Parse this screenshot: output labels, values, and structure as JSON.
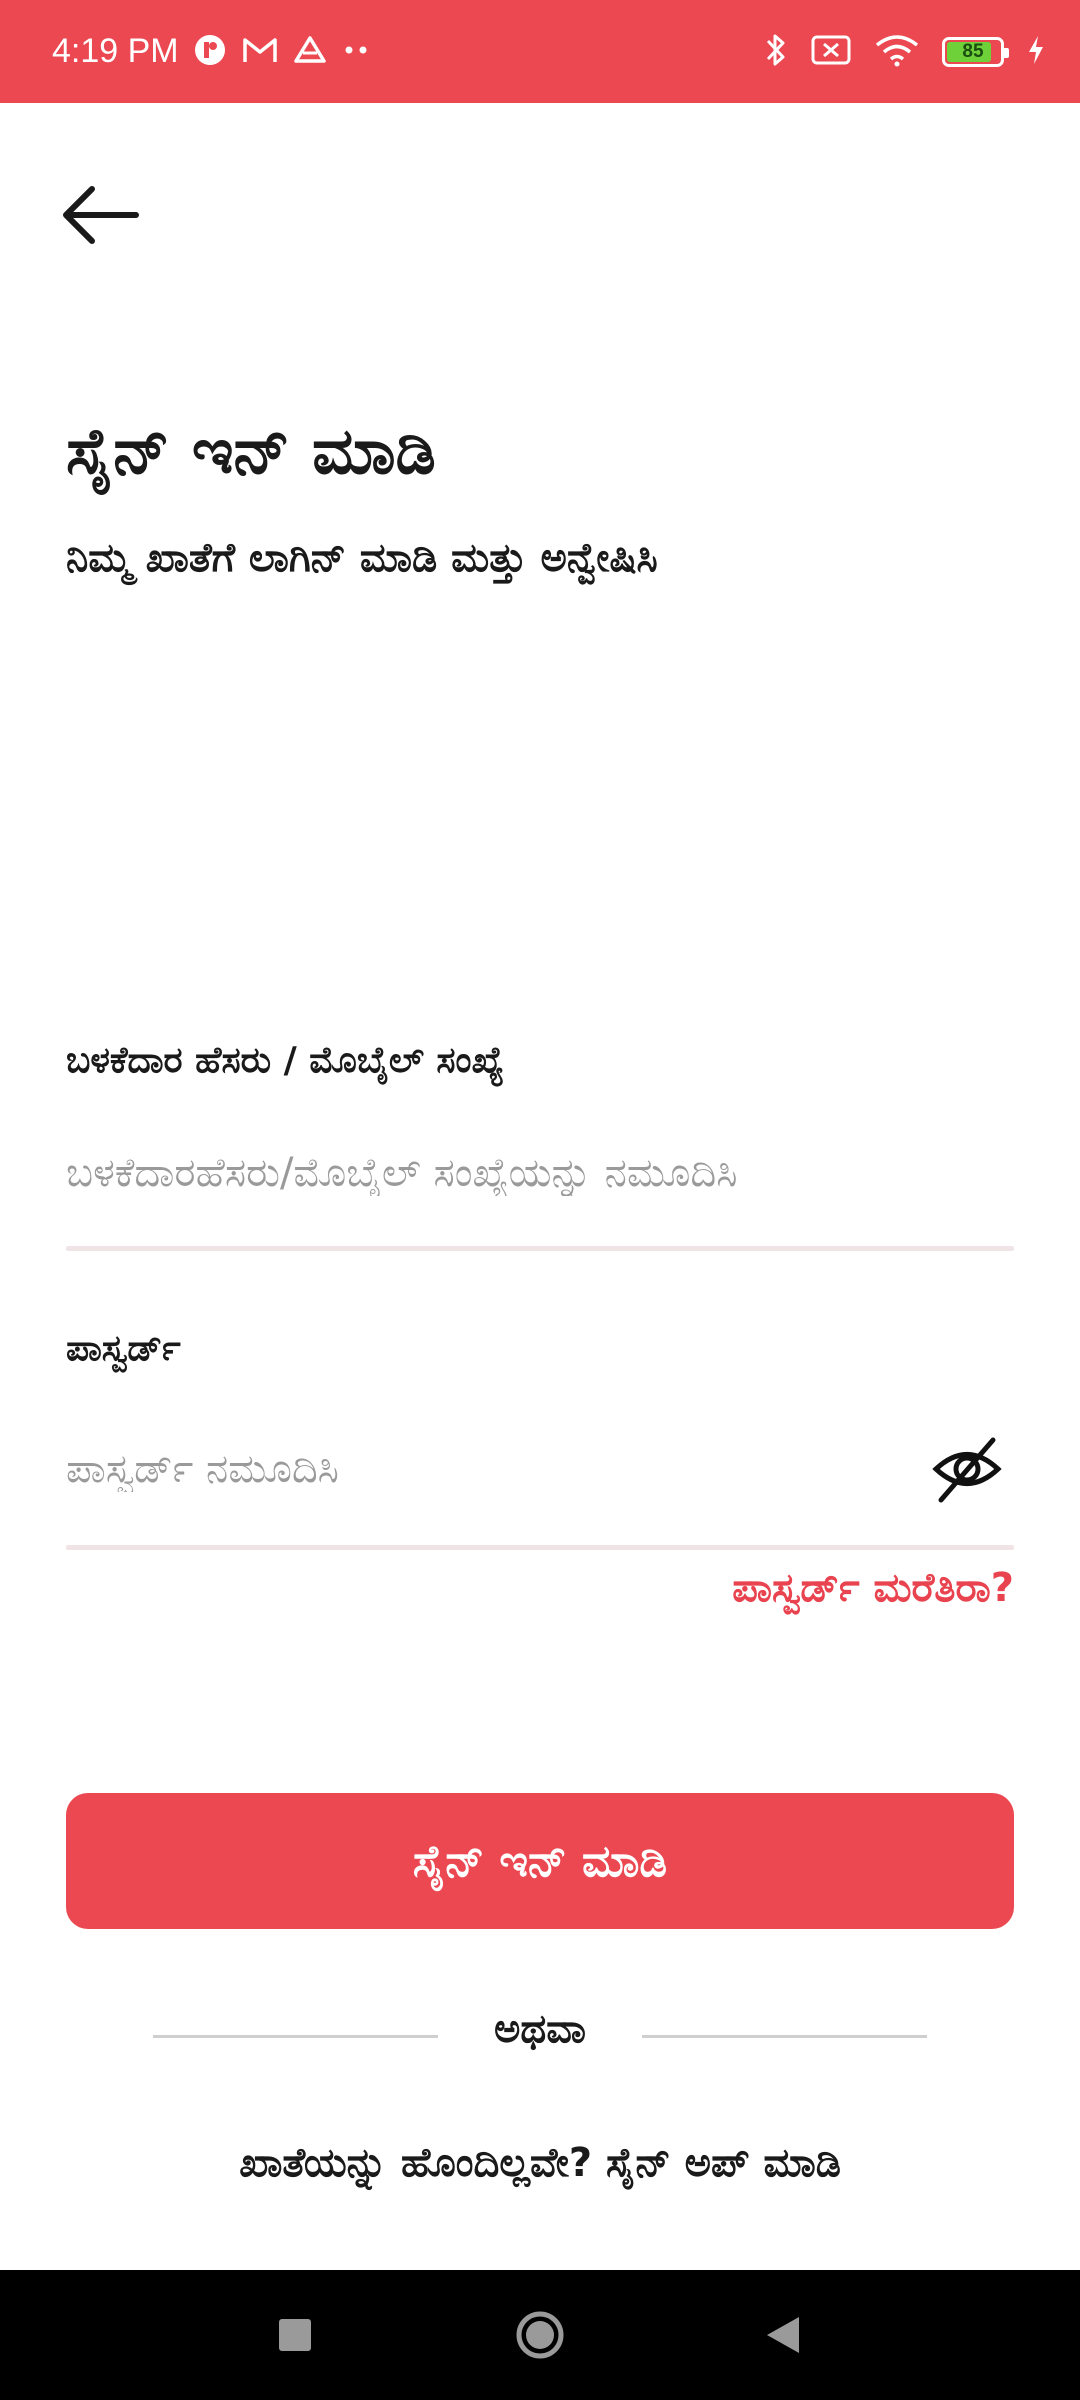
{
  "status_bar": {
    "time": "4:19 PM",
    "battery_level": "85",
    "battery_fraction": 0.85,
    "left_icons": [
      "app-notification-icon",
      "gmail-icon",
      "drive-icon",
      "more-dots-icon"
    ],
    "right_icons": [
      "bluetooth-icon",
      "no-sim-icon",
      "wifi-icon",
      "battery-icon",
      "charging-icon"
    ]
  },
  "header": {
    "back_icon": "arrow-left-icon"
  },
  "main": {
    "title": "ಸೈನ್ ಇನ್ ಮಾಡಿ",
    "subtitle": "ನಿಮ್ಮ ಖಾತೆಗೆ ಲಾಗಿನ್ ಮಾಡಿ ಮತ್ತು ಅನ್ವೇಷಿಸಿ"
  },
  "form": {
    "username": {
      "label": "ಬಳಕೆದಾರ ಹೆಸರು / ಮೊಬೈಲ್ ಸಂಖ್ಯೆ",
      "placeholder": "ಬಳಕೆದಾರಹೆಸರು/ಮೊಬೈಲ್ ಸಂಖ್ಯೆಯನ್ನು ನಮೂದಿಸಿ",
      "value": ""
    },
    "password": {
      "label": "ಪಾಸ್ವರ್ಡ್",
      "placeholder": "ಪಾಸ್ವರ್ಡ್ ನಮೂದಿಸಿ",
      "value": "",
      "toggle_icon": "eye-off-icon"
    },
    "forgot_password": "ಪಾಸ್ವರ್ಡ್ ಮರೆತಿರಾ?",
    "signin_button": "ಸೈನ್ ಇನ್ ಮಾಡಿ"
  },
  "divider": {
    "text": "ಅಥವಾ"
  },
  "signup": {
    "prompt": "ಖಾತೆಯನ್ನು ಹೊಂದಿಲ್ಲವೇ?",
    "link": "ಸೈನ್ ಅಪ್ ಮಾಡಿ"
  },
  "nav_bar": {
    "icons": [
      "recents-icon",
      "home-icon",
      "back-icon"
    ]
  },
  "colors": {
    "accent": "#ec4852",
    "link": "#e8434e",
    "text": "#1a1a1a",
    "placeholder": "#9a9a9a",
    "underline": "#f0e4e6"
  }
}
